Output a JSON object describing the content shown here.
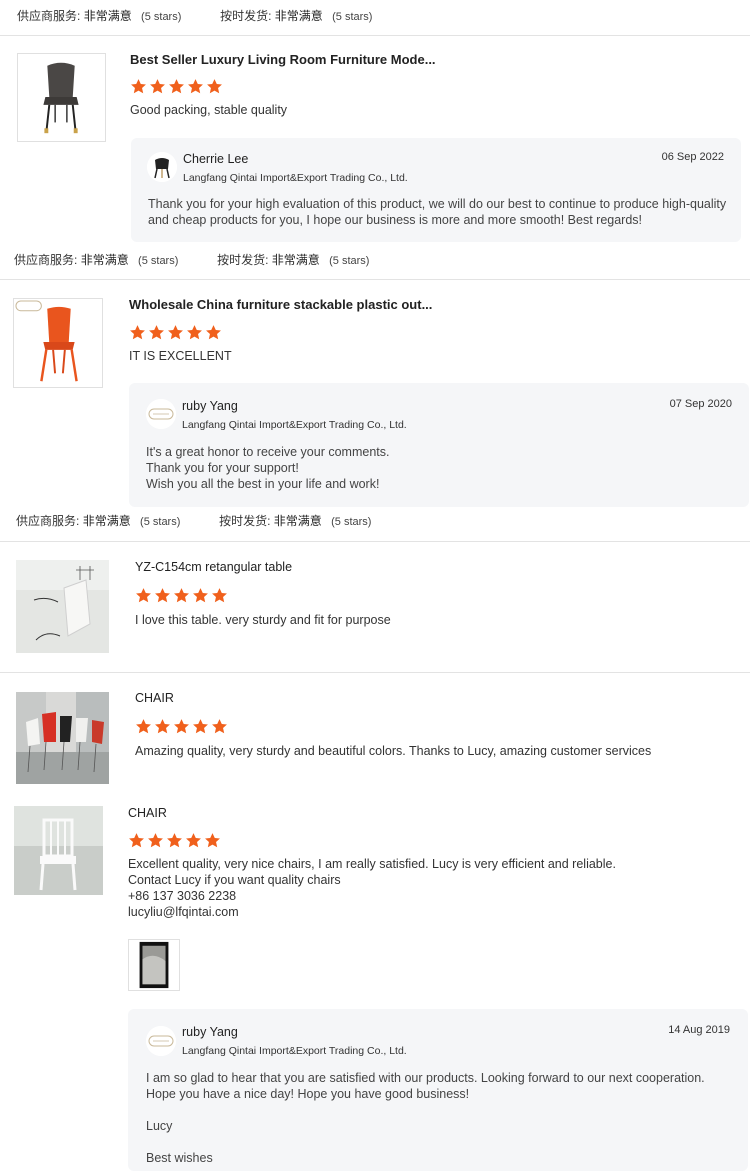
{
  "star_color": "#f0601c",
  "ratings_labels": {
    "service_label": "供应商服务:",
    "service_value": "非常满意",
    "shipping_label": "按时发货:",
    "shipping_value": "非常满意",
    "stars_text": "(5 stars)"
  },
  "reviews": [
    {
      "title": "Best Seller Luxury Living Room Furniture Mode...",
      "rating": 5,
      "text": "Good packing, stable quality",
      "thumb_icon": "dark-upholstered-chair-image",
      "reply": {
        "name": "Cherrie Lee",
        "company": "Langfang Qintai Import&Export Trading Co., Ltd.",
        "date": "06 Sep 2022",
        "lines": [
          "Thank you for your high evaluation of this product, we will do our best to continue to produce high-quality",
          "and cheap products for you, I hope our business is more and more smooth! Best regards!"
        ]
      }
    },
    {
      "title": "Wholesale China furniture stackable plastic out...",
      "rating": 5,
      "text": "IT IS EXCELLENT",
      "thumb_icon": "orange-plastic-chair-image",
      "reply": {
        "name": "ruby Yang",
        "company": "Langfang Qintai Import&Export Trading Co., Ltd.",
        "date": "07 Sep 2020",
        "lines": [
          "It's a great honor to receive your comments.",
          "Thank you for your support!",
          "Wish you all the best in your life and work!"
        ]
      }
    },
    {
      "title": "YZ-C154cm retangular table",
      "rating": 5,
      "text": "I love this table.  very sturdy and fit for purpose",
      "thumb_icon": "table-photo-image"
    },
    {
      "title": "CHAIR",
      "rating": 5,
      "text": "Amazing quality, very sturdy and beautiful colors.  Thanks to Lucy, amazing customer services",
      "thumb_icon": "colorful-chairs-photo-image"
    },
    {
      "title": "CHAIR",
      "rating": 5,
      "lines": [
        "Excellent quality, very nice chairs, I am really satisfied. Lucy is very efficient and reliable.",
        "Contact Lucy if you want quality chairs",
        "+86 137 3036 2238",
        "lucyliu@lfqintai.com"
      ],
      "thumb_icon": "white-chiavari-chair-image",
      "attachment_icon": "review-photo-attachment",
      "reply": {
        "name": "ruby Yang",
        "company": "Langfang Qintai Import&Export Trading Co., Ltd.",
        "date": "14 Aug 2019",
        "lines": [
          "I am so glad to hear that you are satisfied with our products. Looking forward to our next cooperation.",
          "Hope you have a nice day! Hope you have good business!",
          "",
          "Lucy",
          "",
          "Best wishes"
        ]
      }
    }
  ]
}
